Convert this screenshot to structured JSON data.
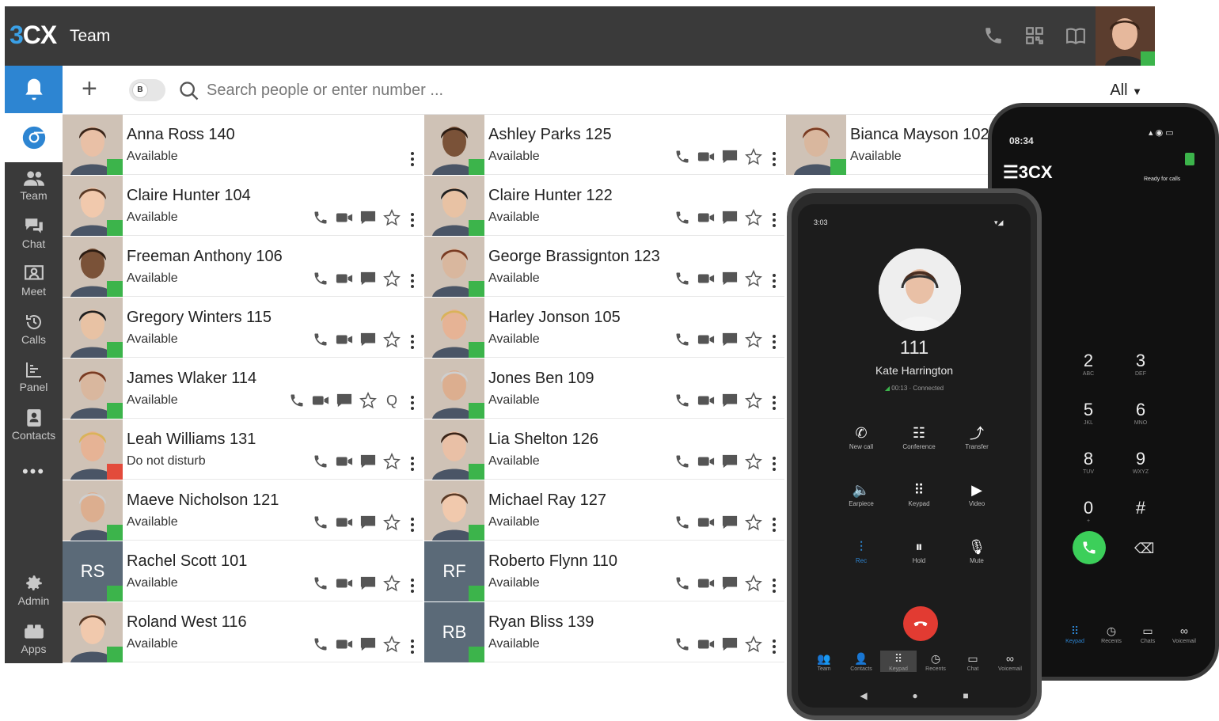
{
  "topbar": {
    "logo_num": "3",
    "logo_txt": "CX",
    "title": "Team"
  },
  "toolbar": {
    "add_label": "+",
    "toggle_label": "B",
    "search_placeholder": "Search people or enter number ...",
    "filter_label": "All"
  },
  "sidebar": {
    "items": [
      {
        "label": "Team",
        "icon": "team-icon"
      },
      {
        "label": "Chat",
        "icon": "chat-icon"
      },
      {
        "label": "Meet",
        "icon": "meet-icon"
      },
      {
        "label": "Calls",
        "icon": "calls-icon"
      },
      {
        "label": "Panel",
        "icon": "panel-icon"
      },
      {
        "label": "Contacts",
        "icon": "contacts-icon"
      }
    ],
    "more": "•••",
    "bottom": [
      {
        "label": "Admin",
        "icon": "gear-icon"
      },
      {
        "label": "Apps",
        "icon": "apps-icon"
      }
    ]
  },
  "contacts": {
    "col1": [
      {
        "name": "Anna Ross 140",
        "status": "Available",
        "initials": ""
      },
      {
        "name": "Claire Hunter 104",
        "status": "Available",
        "initials": ""
      },
      {
        "name": "Freeman Anthony 106",
        "status": "Available",
        "initials": ""
      },
      {
        "name": "Gregory Winters 115",
        "status": "Available",
        "initials": ""
      },
      {
        "name": "James Wlaker 114",
        "status": "Available",
        "initials": ""
      },
      {
        "name": "Leah Williams 131",
        "status": "Do not disturb",
        "initials": ""
      },
      {
        "name": "Maeve Nicholson 121",
        "status": "Available",
        "initials": ""
      },
      {
        "name": "Rachel Scott 101",
        "status": "Available",
        "initials": "RS"
      },
      {
        "name": "Roland West 116",
        "status": "Available",
        "initials": ""
      }
    ],
    "col2": [
      {
        "name": "Ashley Parks 125",
        "status": "Available",
        "initials": ""
      },
      {
        "name": "Claire Hunter 122",
        "status": "Available",
        "initials": ""
      },
      {
        "name": "George Brassignton 123",
        "status": "Available",
        "initials": ""
      },
      {
        "name": "Harley Jonson 105",
        "status": "Available",
        "initials": ""
      },
      {
        "name": "Jones Ben 109",
        "status": "Available",
        "initials": ""
      },
      {
        "name": "Lia Shelton 126",
        "status": "Available",
        "initials": ""
      },
      {
        "name": "Michael Ray 127",
        "status": "Available",
        "initials": ""
      },
      {
        "name": "Roberto Flynn 110",
        "status": "Available",
        "initials": "RF"
      },
      {
        "name": "Ryan Bliss 139",
        "status": "Available",
        "initials": "RB"
      }
    ],
    "col3": [
      {
        "name": "Bianca Mayson 102",
        "status": "Available",
        "initials": ""
      }
    ]
  },
  "front_phone": {
    "time": "3:03",
    "extension": "111",
    "caller": "Kate Harrington",
    "call_status": "00:13 · Connected",
    "buttons_row1": [
      "New call",
      "Conference",
      "Transfer"
    ],
    "buttons_row2": [
      "Earpiece",
      "Keypad",
      "Video"
    ],
    "buttons_row3": [
      "Rec",
      "Hold",
      "Mute"
    ],
    "tabs": [
      "Team",
      "Contacts",
      "Keypad",
      "Recents",
      "Chat",
      "Voicemail"
    ]
  },
  "back_phone": {
    "time": "08:34",
    "logo": "3CX",
    "ready": "Ready for calls",
    "keys": [
      {
        "d": "2",
        "l": "ABC"
      },
      {
        "d": "3",
        "l": "DEF"
      },
      {
        "d": "5",
        "l": "JKL"
      },
      {
        "d": "6",
        "l": "MNO"
      },
      {
        "d": "8",
        "l": "TUV"
      },
      {
        "d": "9",
        "l": "WXYZ"
      },
      {
        "d": "0",
        "l": "+"
      },
      {
        "d": "#",
        "l": ""
      }
    ],
    "tabs": [
      "Keypad",
      "Recents",
      "Chats",
      "Voicemail"
    ]
  },
  "colors": {
    "accent": "#2d85d2",
    "available": "#3cb44b",
    "dnd": "#e34b3b",
    "dark": "#3a3a3a",
    "hangup": "#e23b32",
    "call": "#3ccf5a"
  }
}
